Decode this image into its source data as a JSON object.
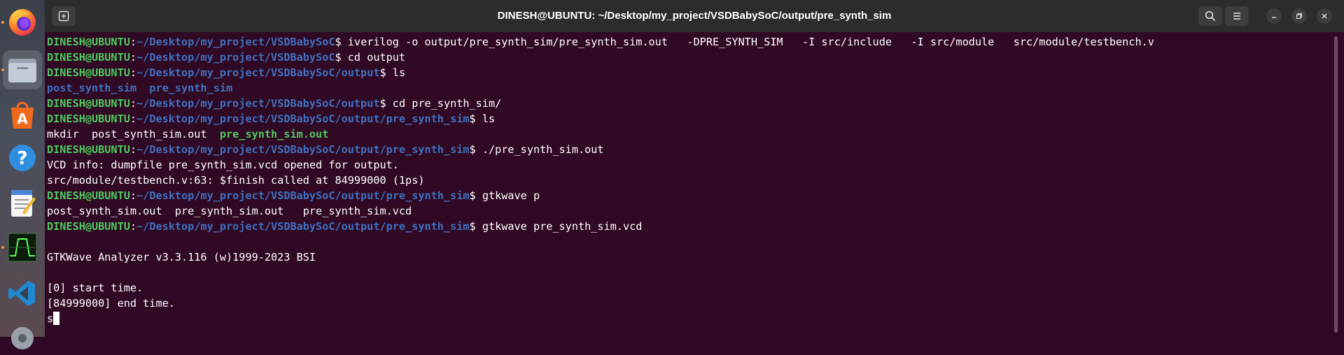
{
  "window": {
    "title": "DINESH@UBUNTU: ~/Desktop/my_project/VSDBabySoC/output/pre_synth_sim"
  },
  "dock": [
    {
      "name": "firefox-icon"
    },
    {
      "name": "files-icon"
    },
    {
      "name": "app-center-icon"
    },
    {
      "name": "help-icon"
    },
    {
      "name": "text-editor-icon"
    },
    {
      "name": "gtkwave-icon"
    },
    {
      "name": "vscode-icon"
    },
    {
      "name": "settings-icon"
    }
  ],
  "colors": {
    "terminal_bg": "#300a24",
    "user_host": "#4ec95f",
    "path": "#3f6fbf",
    "titlebar": "#2c2c2c"
  },
  "terminal": {
    "user": "DINESH@UBUNTU",
    "lines": [
      {
        "type": "prompt",
        "path": "~/Desktop/my_project/VSDBabySoC",
        "cmd": "iverilog -o output/pre_synth_sim/pre_synth_sim.out   -DPRE_SYNTH_SIM   -I src/include   -I src/module   src/module/testbench.v"
      },
      {
        "type": "prompt",
        "path": "~/Desktop/my_project/VSDBabySoC",
        "cmd": "cd output"
      },
      {
        "type": "prompt",
        "path": "~/Desktop/my_project/VSDBabySoC/output",
        "cmd": "ls"
      },
      {
        "type": "dirlist",
        "text": "post_synth_sim  pre_synth_sim"
      },
      {
        "type": "prompt",
        "path": "~/Desktop/my_project/VSDBabySoC/output",
        "cmd": "cd pre_synth_sim/"
      },
      {
        "type": "prompt",
        "path": "~/Desktop/my_project/VSDBabySoC/output/pre_synth_sim",
        "cmd": "ls"
      },
      {
        "type": "filelist",
        "plain": "mkdir  post_synth_sim.out  ",
        "exe": "pre_synth_sim.out"
      },
      {
        "type": "prompt",
        "path": "~/Desktop/my_project/VSDBabySoC/output/pre_synth_sim",
        "cmd": "./pre_synth_sim.out"
      },
      {
        "type": "text",
        "text": "VCD info: dumpfile pre_synth_sim.vcd opened for output."
      },
      {
        "type": "text",
        "text": "src/module/testbench.v:63: $finish called at 84999000 (1ps)"
      },
      {
        "type": "prompt",
        "path": "~/Desktop/my_project/VSDBabySoC/output/pre_synth_sim",
        "cmd": "gtkwave p"
      },
      {
        "type": "text",
        "text": "post_synth_sim.out  pre_synth_sim.out   pre_synth_sim.vcd"
      },
      {
        "type": "prompt",
        "path": "~/Desktop/my_project/VSDBabySoC/output/pre_synth_sim",
        "cmd": "gtkwave pre_synth_sim.vcd"
      },
      {
        "type": "text",
        "text": ""
      },
      {
        "type": "text",
        "text": "GTKWave Analyzer v3.3.116 (w)1999-2023 BSI"
      },
      {
        "type": "text",
        "text": ""
      },
      {
        "type": "text",
        "text": "[0] start time."
      },
      {
        "type": "text",
        "text": "[84999000] end time."
      },
      {
        "type": "input",
        "text": "s"
      }
    ]
  }
}
